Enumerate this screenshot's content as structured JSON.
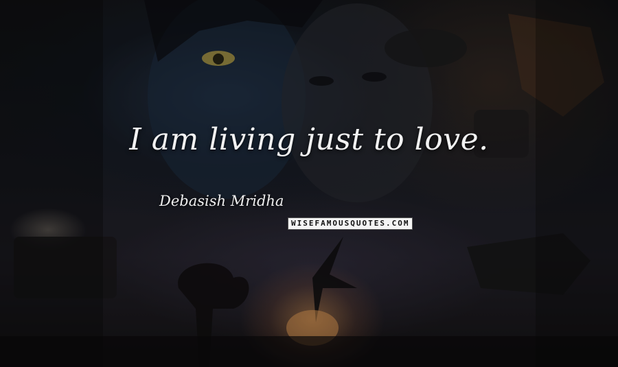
{
  "quote": {
    "text": "I am living just to love.",
    "author": "Debasish Mridha",
    "watermark": "WISEFAMOUSQUOTES.COM"
  },
  "colors": {
    "quote_text": "#f2f2f2",
    "watermark_bg": "#f4f4f4",
    "watermark_text": "#111111",
    "sunset_glow": "#e9a058"
  }
}
